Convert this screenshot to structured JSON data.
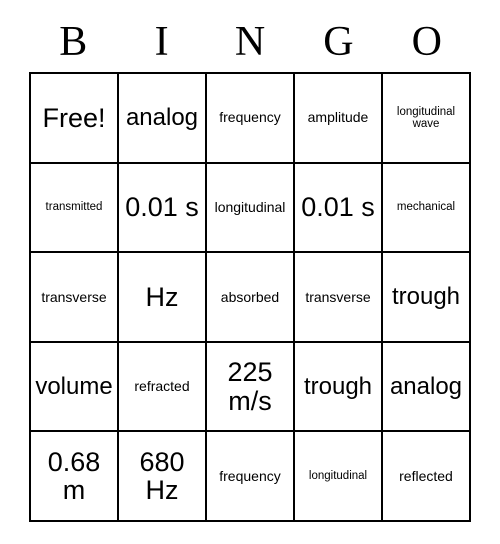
{
  "card": {
    "title_letters": [
      "B",
      "I",
      "N",
      "G",
      "O"
    ],
    "free_space_label": "Free!",
    "grid_size": 5,
    "border_color": "#000000",
    "background_color": "#ffffff",
    "text_color": "#000000",
    "rows": [
      [
        {
          "text": "Free!",
          "size": "fs-xl"
        },
        {
          "text": "analog",
          "size": "fs-lg"
        },
        {
          "text": "frequency",
          "size": "fs-sm"
        },
        {
          "text": "amplitude",
          "size": "fs-sm"
        },
        {
          "text": "longitudinal wave",
          "size": "fs-xs"
        }
      ],
      [
        {
          "text": "transmitted",
          "size": "fs-xs"
        },
        {
          "text": "0.01 s",
          "size": "fs-xl"
        },
        {
          "text": "longitudinal",
          "size": "fs-sm"
        },
        {
          "text": "0.01 s",
          "size": "fs-xl"
        },
        {
          "text": "mechanical",
          "size": "fs-xs"
        }
      ],
      [
        {
          "text": "transverse",
          "size": "fs-sm"
        },
        {
          "text": "Hz",
          "size": "fs-xl"
        },
        {
          "text": "absorbed",
          "size": "fs-sm"
        },
        {
          "text": "transverse",
          "size": "fs-sm"
        },
        {
          "text": "trough",
          "size": "fs-lg"
        }
      ],
      [
        {
          "text": "volume",
          "size": "fs-lg"
        },
        {
          "text": "refracted",
          "size": "fs-sm"
        },
        {
          "text": "225 m/s",
          "size": "fs-xl"
        },
        {
          "text": "trough",
          "size": "fs-lg"
        },
        {
          "text": "analog",
          "size": "fs-lg"
        }
      ],
      [
        {
          "text": "0.68 m",
          "size": "fs-xl"
        },
        {
          "text": "680 Hz",
          "size": "fs-xl"
        },
        {
          "text": "frequency",
          "size": "fs-sm"
        },
        {
          "text": "longitudinal",
          "size": "fs-xs"
        },
        {
          "text": "reflected",
          "size": "fs-sm"
        }
      ]
    ]
  }
}
